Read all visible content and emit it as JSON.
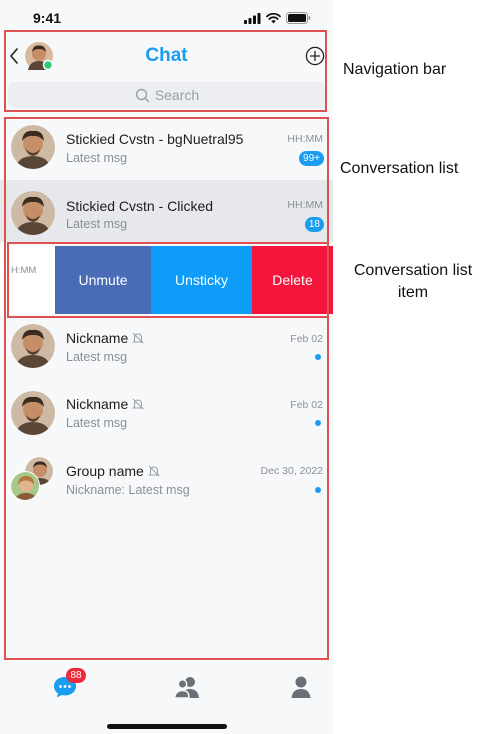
{
  "status_bar": {
    "time": "9:41",
    "signal_icon": "signal-icon",
    "wifi_icon": "wifi-icon",
    "battery_icon": "battery-icon"
  },
  "navbar": {
    "title": "Chat",
    "back_icon": "chevron-left-icon",
    "add_icon": "plus-circle-icon",
    "online_color": "#2ecc71"
  },
  "search": {
    "placeholder": "Search",
    "icon": "search-icon"
  },
  "conversations": [
    {
      "name": "Stickied Cvstn - bgNuetral95",
      "message": "Latest msg",
      "time": "HH:MM",
      "badge": "99+",
      "muted": false
    },
    {
      "name": "Stickied Cvstn - Clicked",
      "message": "Latest msg",
      "time": "HH:MM",
      "badge": "18",
      "muted": false,
      "state": "pressed"
    },
    {
      "name": "Nickname",
      "message": "Latest msg",
      "time": "Feb 02",
      "unread_dot": true,
      "muted": true
    },
    {
      "name": "Nickname",
      "message": "Latest msg",
      "time": "Feb 02",
      "unread_dot": true,
      "muted": true
    },
    {
      "name": "Group name",
      "message": "Nickname: Latest msg",
      "time": "Dec 30, 2022",
      "unread_dot": true,
      "muted": true,
      "group": true
    }
  ],
  "swipe_row": {
    "time": "H:MM",
    "actions": [
      {
        "label": "Unmute",
        "color": "#4a6cb5"
      },
      {
        "label": "Unsticky",
        "color": "#0d9cf8"
      },
      {
        "label": "Delete",
        "color": "#f5143c"
      }
    ]
  },
  "tabbar": {
    "chat_badge": "88",
    "tabs": [
      "chat-icon",
      "contacts-icon",
      "profile-icon"
    ],
    "active_color": "#1a9cf0",
    "inactive_color": "#6b7078"
  },
  "annotations": {
    "navigation_bar": "Navigation bar",
    "conversation_list": "Conversation list",
    "conversation_list_item": "Conversation list item"
  },
  "colors": {
    "accent": "#1a9cf0",
    "annotation": "#e05050",
    "pressed_row": "#e6e8eb"
  }
}
